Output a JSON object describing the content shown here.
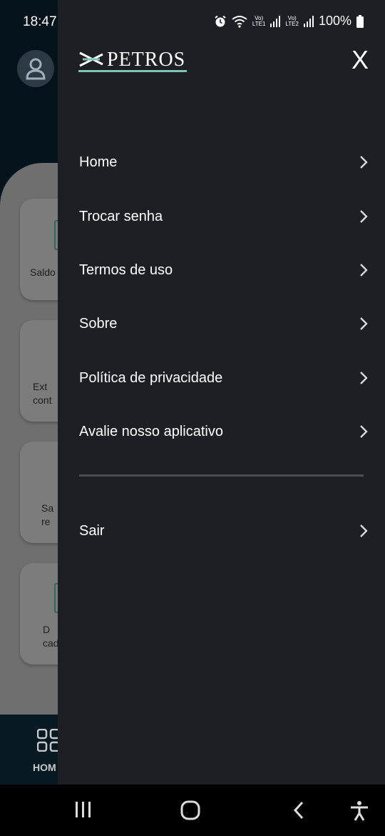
{
  "status_bar": {
    "time": "18:47",
    "battery": "100%",
    "sim1_top": "Vo)",
    "sim1_bottom": "LTE1",
    "sim2_top": "Vo)",
    "sim2_bottom": "LTE2"
  },
  "background": {
    "cards": [
      {
        "label": "Saldo"
      },
      {
        "label": "Ext\ncont"
      },
      {
        "label": "Sa\nre"
      },
      {
        "label": "D\ncad"
      }
    ],
    "nav_label": "HOM"
  },
  "drawer": {
    "logo_text": "PETROS",
    "close_label": "X",
    "menu": [
      {
        "label": "Home"
      },
      {
        "label": "Trocar senha"
      },
      {
        "label": "Termos de uso"
      },
      {
        "label": "Sobre"
      },
      {
        "label": "Política de privacidade"
      },
      {
        "label": "Avalie nosso aplicativo"
      }
    ],
    "logout_label": "Sair"
  },
  "colors": {
    "drawer_bg": "#1e1f24",
    "logo_accent": "#7dc6b5",
    "text": "#ffffff"
  },
  "icons": [
    "alarm-icon",
    "wifi-icon",
    "signal-icon",
    "battery-icon",
    "chevron-right-icon",
    "recent-apps-icon",
    "home-circle-icon",
    "back-icon",
    "accessibility-icon",
    "grid-icon",
    "user-icon"
  ]
}
